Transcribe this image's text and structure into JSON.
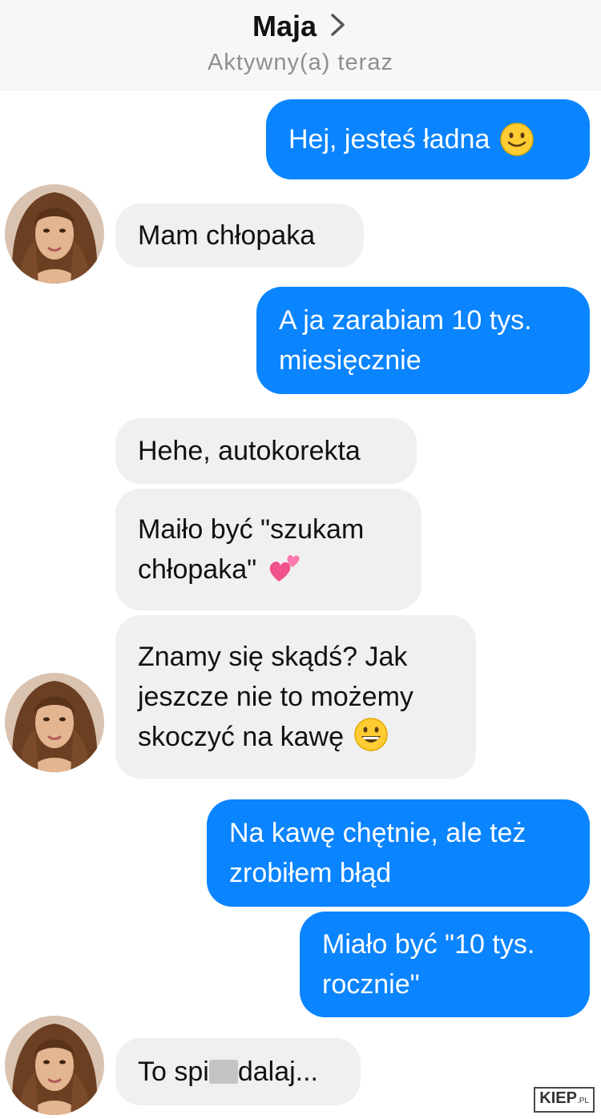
{
  "header": {
    "contact_name": "Maja",
    "status": "Aktywny(a) teraz"
  },
  "messages": [
    {
      "side": "out",
      "text": "Hej, jesteś ładna",
      "emoji": "slightly-smiling-face-emoji"
    },
    {
      "side": "in",
      "text": "Mam chłopaka"
    },
    {
      "side": "out",
      "text": "A ja zarabiam 10 tys.\nmiesięcznie"
    },
    {
      "side": "in",
      "text": "Hehe, autokorekta"
    },
    {
      "side": "in",
      "text": "Maiło być \"szukam\nchłopaka\"",
      "emoji": "two-hearts-emoji"
    },
    {
      "side": "in",
      "text": "Znamy się skądś? Jak\njeszcze nie to możemy\nskoczyć na kawę",
      "emoji": "grinning-face-emoji"
    },
    {
      "side": "out",
      "text": "Na kawę chętnie, ale też\nzrobiłem błąd"
    },
    {
      "side": "out",
      "text": "Miało być \"10 tys.\nrocznie\""
    },
    {
      "side": "in",
      "text_before": "To spi",
      "text_after": "dalaj...",
      "censored": true
    }
  ],
  "watermark": {
    "brand": "KIEP",
    "suffix": ".PL"
  },
  "colors": {
    "outgoing_bubble": "#0a84ff",
    "incoming_bubble": "#f1f0f0",
    "header_bg": "#f7f7f7",
    "status_text": "#8e8e93"
  },
  "icons": {
    "header_chevron": "chevron-right-icon",
    "avatar": "contact-avatar-photo"
  }
}
